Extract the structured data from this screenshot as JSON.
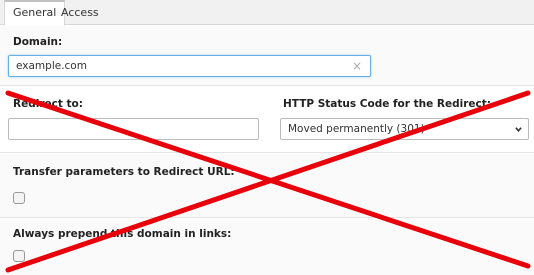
{
  "tabs": [
    {
      "label": "General"
    },
    {
      "label": "Access"
    }
  ],
  "domain": {
    "label": "Domain:",
    "value": "example.com",
    "clear_icon": "×"
  },
  "redirect": {
    "label": "Redirect to:",
    "value": ""
  },
  "status_code": {
    "label": "HTTP Status Code for the Redirect:",
    "selected": "Moved permanently (301)"
  },
  "transfer_params": {
    "label": "Transfer parameters to Redirect URL:",
    "checked": false
  },
  "prepend_domain": {
    "label": "Always prepend this domain in links:",
    "checked": false
  },
  "overlay": {
    "mark": "red-x-cross",
    "color": "#e8000b"
  }
}
